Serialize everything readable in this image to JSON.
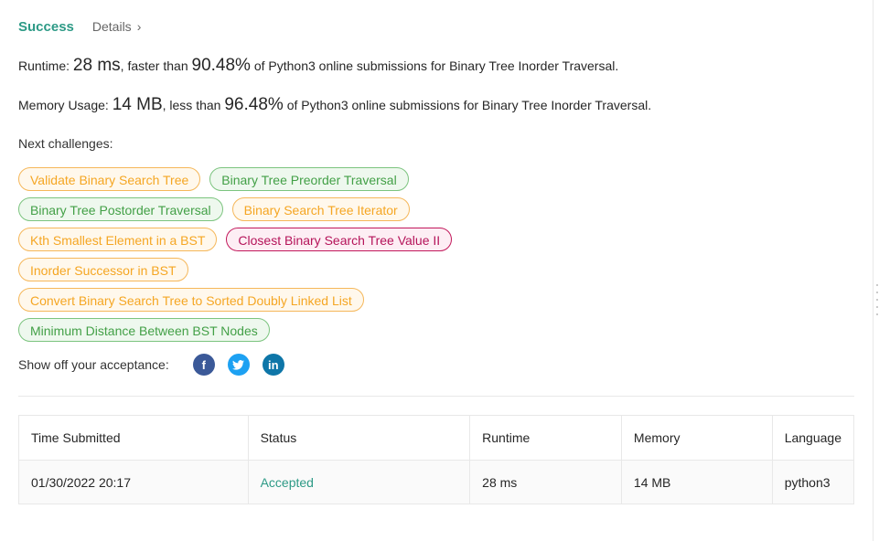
{
  "header": {
    "status": "Success",
    "details_label": "Details",
    "details_chevron": "›"
  },
  "runtime": {
    "label": "Runtime:",
    "value": "28 ms",
    "comparison_prefix": ", faster than",
    "percent": "90.48%",
    "suffix": "of Python3 online submissions for Binary Tree Inorder Traversal."
  },
  "memory": {
    "label": "Memory Usage:",
    "value": "14 MB",
    "comparison_prefix": ", less than",
    "percent": "96.48%",
    "suffix": "of Python3 online submissions for Binary Tree Inorder Traversal."
  },
  "next_challenges": {
    "label": "Next challenges:",
    "rows": [
      [
        {
          "label": "Validate Binary Search Tree",
          "difficulty": "medium"
        },
        {
          "label": "Binary Tree Preorder Traversal",
          "difficulty": "easy"
        }
      ],
      [
        {
          "label": "Binary Tree Postorder Traversal",
          "difficulty": "easy"
        },
        {
          "label": "Binary Search Tree Iterator",
          "difficulty": "medium"
        }
      ],
      [
        {
          "label": "Kth Smallest Element in a BST",
          "difficulty": "medium"
        },
        {
          "label": "Closest Binary Search Tree Value II",
          "difficulty": "hard"
        }
      ],
      [
        {
          "label": "Inorder Successor in BST",
          "difficulty": "medium"
        }
      ],
      [
        {
          "label": "Convert Binary Search Tree to Sorted Doubly Linked List",
          "difficulty": "medium"
        }
      ],
      [
        {
          "label": "Minimum Distance Between BST Nodes",
          "difficulty": "easy"
        }
      ]
    ]
  },
  "share": {
    "label": "Show off your acceptance:",
    "icons": [
      {
        "name": "facebook-icon",
        "glyph": "f",
        "color": "#3b5998"
      },
      {
        "name": "twitter-icon",
        "glyph": "t",
        "color": "#1da1f2"
      },
      {
        "name": "linkedin-icon",
        "glyph": "in",
        "color": "#0e76a8"
      }
    ]
  },
  "submissions": {
    "headers": [
      "Time Submitted",
      "Status",
      "Runtime",
      "Memory",
      "Language"
    ],
    "rows": [
      [
        "01/30/2022 20:17",
        "Accepted",
        "28 ms",
        "14 MB",
        "python3"
      ]
    ]
  },
  "colors": {
    "success": "#2d9a86",
    "medium": "#f5a623",
    "easy": "#43a047",
    "hard": "#b5145a"
  }
}
